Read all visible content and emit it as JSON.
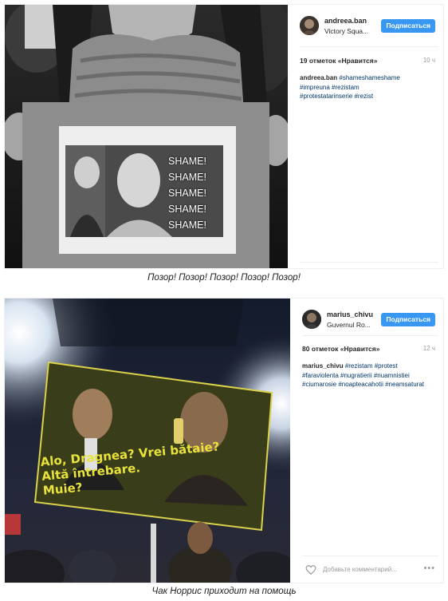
{
  "posts": [
    {
      "username": "andreea.ban",
      "location": "Victory Squa...",
      "follow_label": "Подписаться",
      "likes": "19 отметок «Нравится»",
      "time": "10 ч",
      "caption_user": "andreea.ban",
      "hashtags_line1": "#shameshameshame",
      "hashtags_line2": "#impreuna #rezistam",
      "hashtags_line3": "#protestatarinserie #rezist",
      "sign_words": [
        "SHAME!",
        "SHAME!",
        "SHAME!",
        "SHAME!",
        "SHAME!"
      ],
      "caption_text": "Позор! Позор! Позор! Позор! Позор!"
    },
    {
      "username": "marius_chivu",
      "location": "Guvernul Ro...",
      "follow_label": "Подписаться",
      "likes": "80 отметок «Нравится»",
      "time": "12 ч",
      "caption_user": "marius_chivu",
      "hashtags_line1": "#rezistam #protest",
      "hashtags_line2": "#faraviolenta #nugratierii #nuamnistiei",
      "hashtags_line3": "#ciumarosie #noapteacahotii #neamsaturat",
      "sign_line1": "Alo, Dragnea? Vrei bătaie?",
      "sign_line2": "Altă întrebare.",
      "sign_line3": "Muie?",
      "add_comment_placeholder": "Добавьте комментарий...",
      "more_label": "•••",
      "caption_text": "Чак Норрис приходит на помощь"
    }
  ],
  "colors": {
    "follow_button": "#3897f0",
    "hashtag": "#003569",
    "sign_yellow": "#e8e23a"
  }
}
